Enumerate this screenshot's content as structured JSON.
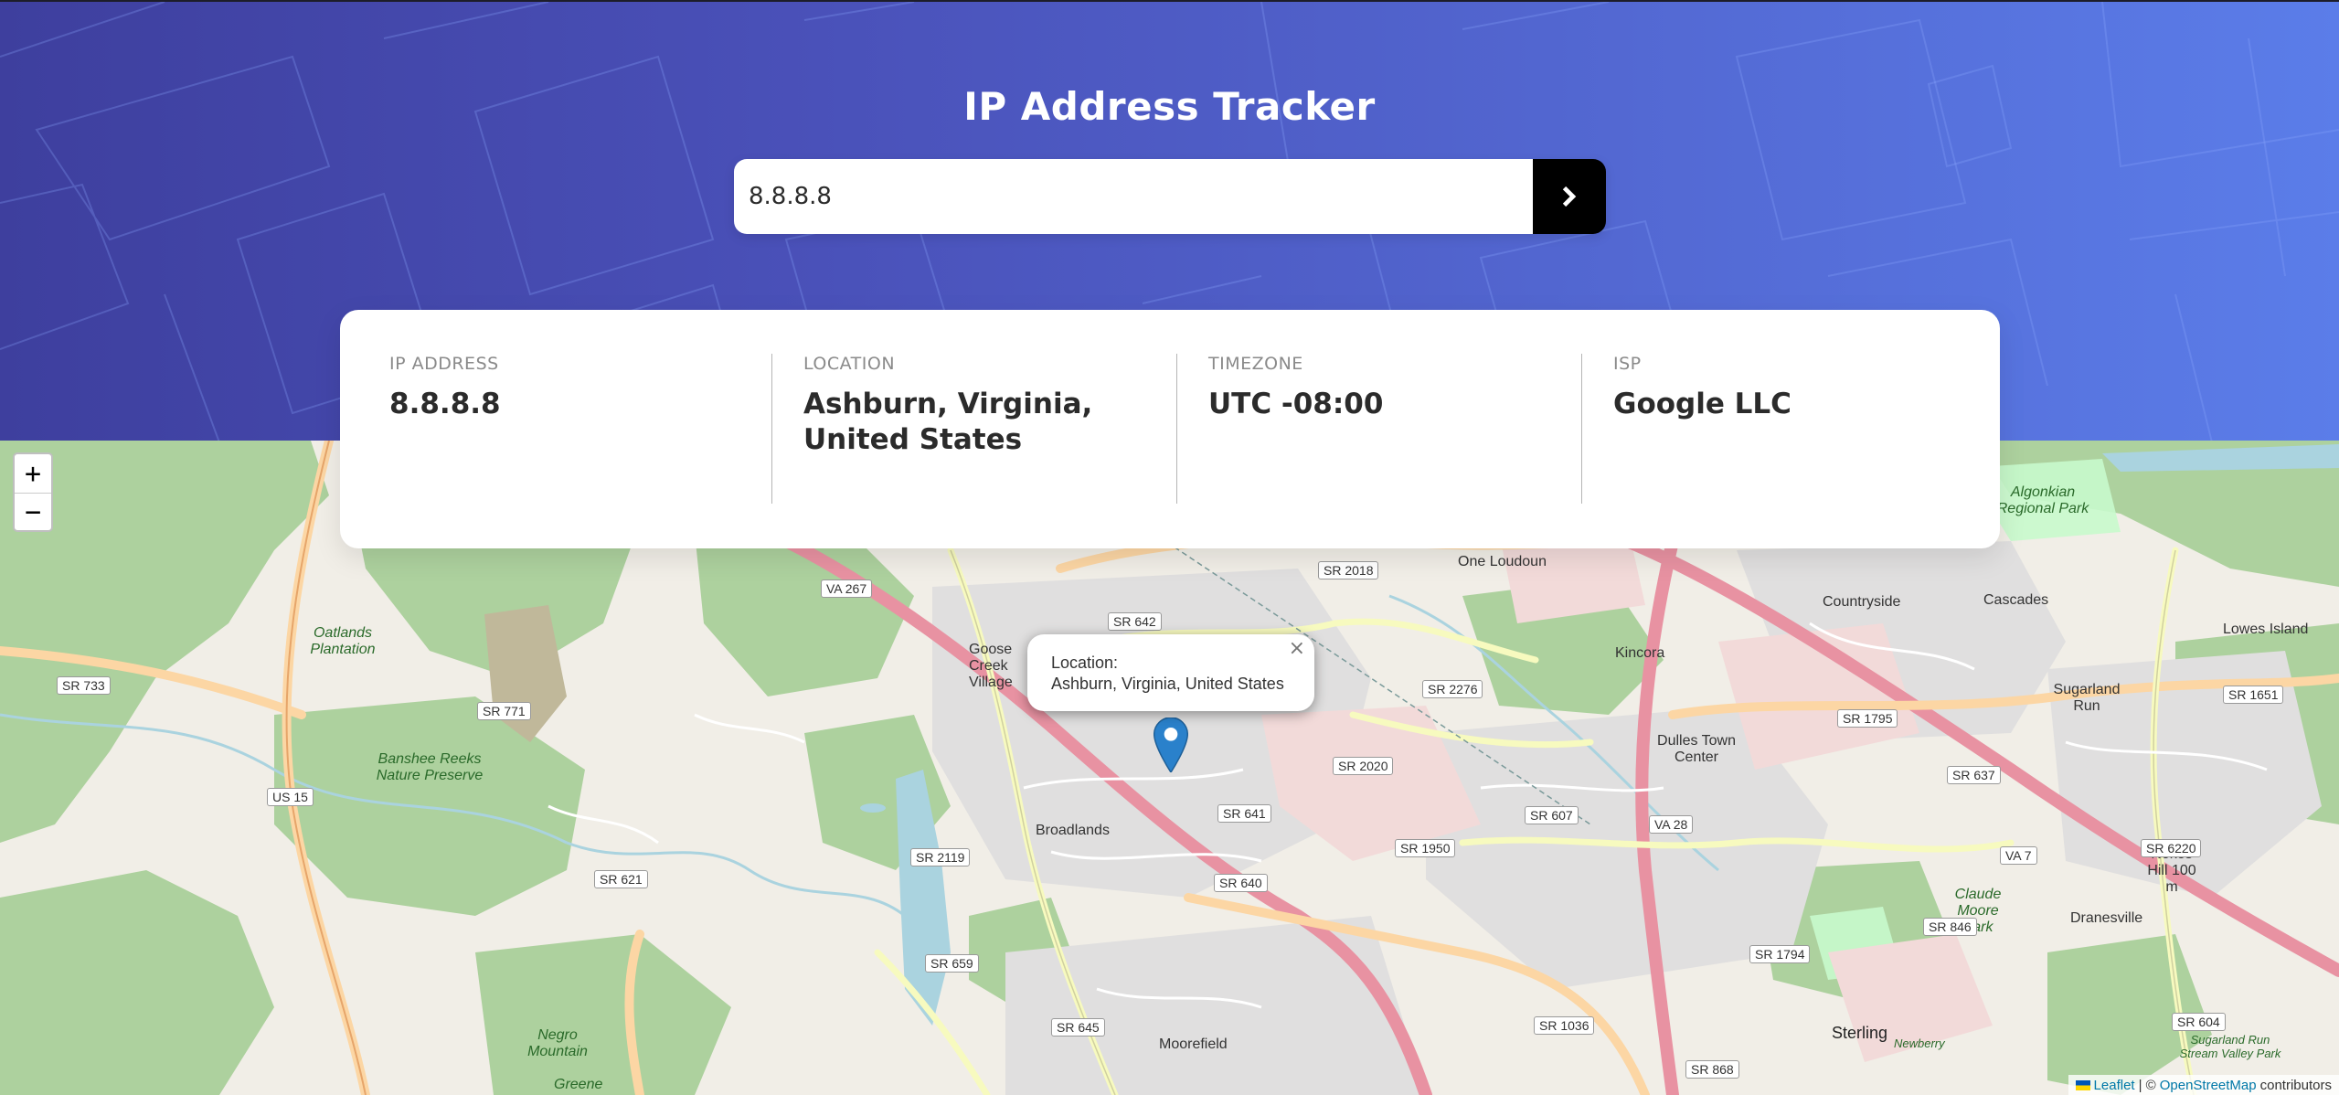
{
  "header": {
    "title": "IP Address Tracker",
    "background_gradient": [
      "#3e3f9e",
      "#5b7de9"
    ]
  },
  "search": {
    "value": "8.8.8.8",
    "button_icon": "chevron-right-icon"
  },
  "info": {
    "ip_label": "IP ADDRESS",
    "ip_value": "8.8.8.8",
    "location_label": "LOCATION",
    "location_value": "Ashburn, Virginia, United States",
    "timezone_label": "TIMEZONE",
    "timezone_value": "UTC -08:00",
    "isp_label": "ISP",
    "isp_value": "Google LLC"
  },
  "map": {
    "zoom_in": "+",
    "zoom_out": "−",
    "popup_title": "Location:",
    "popup_text": "Ashburn, Virginia, United States",
    "popup_close": "×",
    "attribution": {
      "leaflet": "Leaflet",
      "separator": "| ©",
      "osm": "OpenStreetMap",
      "contributors": "contributors"
    },
    "places": [
      "One Loudoun",
      "Countryside",
      "Cascades",
      "Lowes Island",
      "Kincora",
      "Sugarland Run",
      "Dulles Town Center",
      "Broadlands",
      "Moorefield",
      "Sterling",
      "Dranesville",
      "Goose Creek Village",
      "Algonkian Regional Park",
      "Oatlands Plantation",
      "Banshee Reeks Nature Preserve",
      "Negro Mountain",
      "Nokes Hill 100 m",
      "Claude Moore Park",
      "Sugarland Run Stream Valley Park",
      "Greene",
      "Newberry"
    ],
    "shields": [
      "SR 733",
      "VA 267",
      "SR 642",
      "SR 2018",
      "SR 771",
      "US 15",
      "SR 2276",
      "SR 1795",
      "SR 1651",
      "SR 2020",
      "SR 641",
      "SR 637",
      "SR 2119",
      "SR 607",
      "VA 28",
      "SR 1950",
      "VA 7",
      "SR 6220",
      "SR 621",
      "SR 640",
      "SR 846",
      "SR 659",
      "SR 1794",
      "SR 645",
      "SR 1036",
      "SR 604",
      "SR 868"
    ]
  }
}
